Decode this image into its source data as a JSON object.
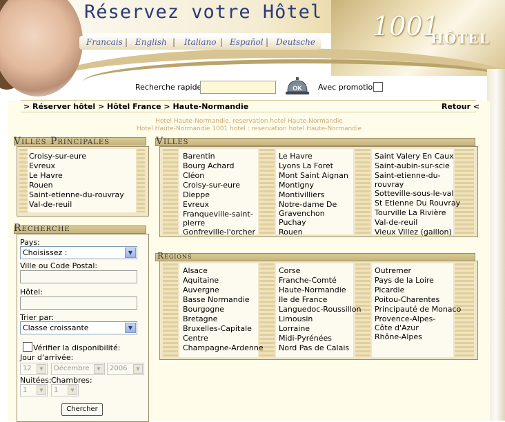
{
  "header": {
    "title": "Réservez votre Hôtel",
    "brand_number": "1001",
    "brand_word": "HÔTEL",
    "languages": [
      "Francais",
      "English",
      "Italiano",
      "Español",
      "Deutsche"
    ],
    "quick_search_label": "Recherche rapide",
    "quick_search_value": "",
    "ok_label": "OK",
    "promo_label": "Avec promotion"
  },
  "breadcrumb": "> Réserver hôtel > Hôtel France > Haute-Normandie",
  "retour": "Retour <",
  "subtitle1": "Hotel Haute-Normandie, reservation hotel Haute-Normandie",
  "subtitle2": "Hotel Haute-Normandie 1001 hotel : reservation hotel Haute-Normandie",
  "villes_principales": {
    "title": "Villes Principales",
    "items": [
      "Croisy-sur-eure",
      "Evreux",
      "Le Havre",
      "Rouen",
      "Saint-etienne-du-rouvray",
      "Val-de-reuil"
    ]
  },
  "villes": {
    "title": "Villes",
    "columns": [
      [
        "Barentin",
        "Bourg Achard",
        "Cléon",
        "Croisy-sur-eure",
        "Dieppe",
        "Evreux",
        "Franqueville-saint-pierre",
        "Gonfreville-l'orcher"
      ],
      [
        "Le Havre",
        "Lyons La Foret",
        "Mont Saint Aignan",
        "Montigny",
        "Montivilliers",
        "Notre-dame De Gravenchon",
        "Puchay",
        "Rouen"
      ],
      [
        "Saint Valery En Caux",
        "Saint-aubin-sur-scie",
        "Saint-etienne-du-rouvray",
        "Sotteville-sous-le-val",
        "St Etienne Du Rouvray",
        "Tourville La Rivière",
        "Val-de-reuil",
        "Vieux Villez (gaillon)"
      ]
    ]
  },
  "regions": {
    "title": "Régions",
    "columns": [
      [
        "Alsace",
        "Aquitaine",
        "Auvergne",
        "Basse Normandie",
        "Bourgogne",
        "Bretagne",
        "Bruxelles-Capitale",
        "Centre",
        "Champagne-Ardenne"
      ],
      [
        "Corse",
        "Franche-Comté",
        "Haute-Normandie",
        "Ile de France",
        "Languedoc-Roussillon",
        "Limousin",
        "Lorraine",
        "Midi-Pyrénées",
        "Nord Pas de Calais"
      ],
      [
        "Outremer",
        "Pays de la Loire",
        "Picardie",
        "Poitou-Charentes",
        "Principauté de Monaco",
        "Provence-Alpes-Côte d'Azur",
        "Rhône-Alpes"
      ]
    ]
  },
  "recherche": {
    "title": "Recherche",
    "pays_label": "Pays:",
    "pays_value": "Choisissez :",
    "ville_label": "Ville ou Code Postal:",
    "hotel_label": "Hôtel:",
    "trier_label": "Trier par:",
    "trier_value": "Classe croissante",
    "verifier_label": "Vérifier la disponibilité:",
    "jour_label": "Jour d'arrivée:",
    "day": "12",
    "month": "Décembre",
    "year": "2006",
    "nuitees_label": "Nuitées:",
    "chambres_label": "Chambres:",
    "nuitees_value": "1",
    "chambres_value": "1",
    "search_button": "Chercher"
  }
}
